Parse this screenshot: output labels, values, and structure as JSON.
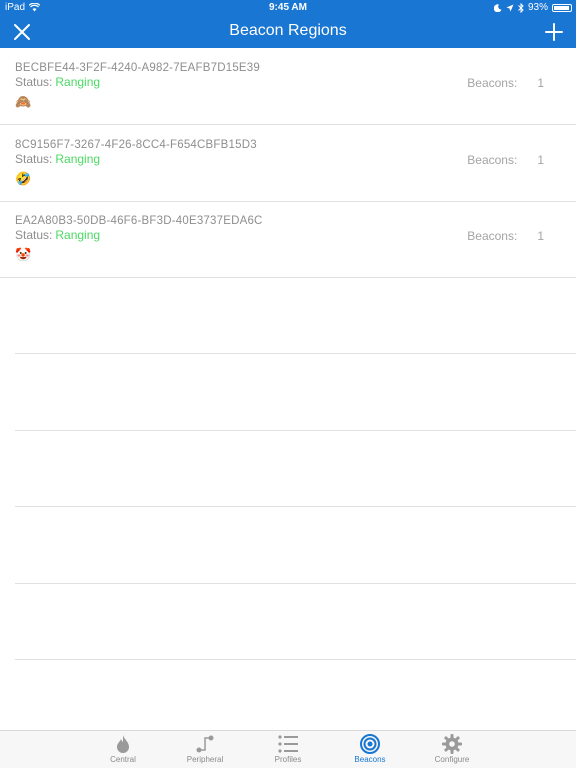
{
  "status_bar": {
    "device": "iPad",
    "time": "9:45 AM",
    "battery": "93%",
    "battery_level": 0.93
  },
  "nav": {
    "title": "Beacon Regions",
    "close_icon": "close-icon",
    "add_icon": "plus-icon"
  },
  "regions": [
    {
      "uuid": "BECBFE44-3F2F-4240-A982-7EAFB7D15E39",
      "status_label": "Status:",
      "status_value": "Ranging",
      "emoji": "🙈",
      "beacons_label": "Beacons:",
      "beacons_count": "1"
    },
    {
      "uuid": "8C9156F7-3267-4F26-8CC4-F654CBFB15D3",
      "status_label": "Status:",
      "status_value": "Ranging",
      "emoji": "🤣",
      "beacons_label": "Beacons:",
      "beacons_count": "1"
    },
    {
      "uuid": "EA2A80B3-50DB-46F6-BF3D-40E3737EDA6C",
      "status_label": "Status:",
      "status_value": "Ranging",
      "emoji": "🤡",
      "beacons_label": "Beacons:",
      "beacons_count": "1"
    }
  ],
  "tabs": [
    {
      "label": "Central",
      "icon": "flame-icon"
    },
    {
      "label": "Peripheral",
      "icon": "peripheral-icon"
    },
    {
      "label": "Profiles",
      "icon": "list-icon"
    },
    {
      "label": "Beacons",
      "icon": "beacon-icon",
      "active": true
    },
    {
      "label": "Configure",
      "icon": "gear-icon"
    }
  ],
  "colors": {
    "accent": "#1976d2",
    "status_ok": "#4cd964"
  }
}
